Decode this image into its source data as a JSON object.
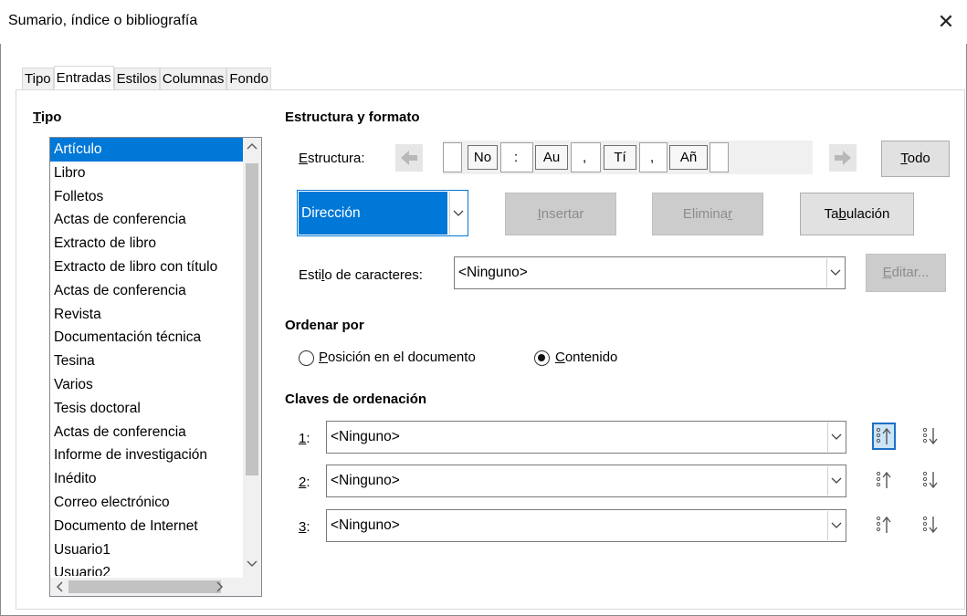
{
  "window": {
    "title": "Sumario, índice o bibliografía",
    "close_glyph": "✕"
  },
  "tabs": [
    {
      "label": "Tipo",
      "active": false
    },
    {
      "label": "Entradas",
      "active": true
    },
    {
      "label": "Estilos",
      "active": false
    },
    {
      "label": "Columnas",
      "active": false
    },
    {
      "label": "Fondo",
      "active": false
    }
  ],
  "type_section": {
    "title_first": "T",
    "title_rest": "ipo",
    "items": [
      "Artículo",
      "Libro",
      "Folletos",
      "Actas de conferencia",
      "Extracto de libro",
      "Extracto de libro con título",
      "Actas de conferencia",
      "Revista",
      "Documentación técnica",
      "Tesina",
      "Varios",
      "Tesis doctoral",
      "Actas de conferencia",
      "Informe de investigación",
      "Inédito",
      "Correo electrónico",
      "Documento de Internet",
      "Usuario1",
      "Usuario2"
    ],
    "selected_index": 0
  },
  "structure": {
    "section_title": "Estructura y formato",
    "label_first": "E",
    "label_rest": "structura:",
    "tokens": [
      "No",
      "Au",
      "Tí",
      "Añ"
    ],
    "separators": [
      ":",
      ",",
      ","
    ],
    "all_button_first": "T",
    "all_button_rest": "odo",
    "field_combo_value": "Dirección",
    "insert_pre": "",
    "insert_u": "I",
    "insert_post": "nsertar",
    "remove_pre": "Elimina",
    "remove_u": "r",
    "remove_post": "",
    "tab_pre": "Ta",
    "tab_u": "b",
    "tab_post": "ulación",
    "char_style_label_pre": "Esti",
    "char_style_label_u": "l",
    "char_style_label_post": "o de caracteres:",
    "char_style_value": "<Ninguno>",
    "edit_pre": "",
    "edit_u": "E",
    "edit_post": "ditar..."
  },
  "sort_by": {
    "title": "Ordenar por",
    "option1_first": "P",
    "option1_rest": "osición en el documento",
    "option2_first": "C",
    "option2_rest": "ontenido",
    "selected": "content"
  },
  "sort_keys": {
    "title": "Claves de ordenación",
    "keys": [
      {
        "num": "1",
        "suffix": ":",
        "value": "<Ninguno>"
      },
      {
        "num": "2",
        "suffix": ":",
        "value": "<Ninguno>"
      },
      {
        "num": "3",
        "suffix": ":",
        "value": "<Ninguno>"
      }
    ]
  },
  "colors": {
    "accent": "#0078d7",
    "focus_border": "#1e70c4"
  }
}
